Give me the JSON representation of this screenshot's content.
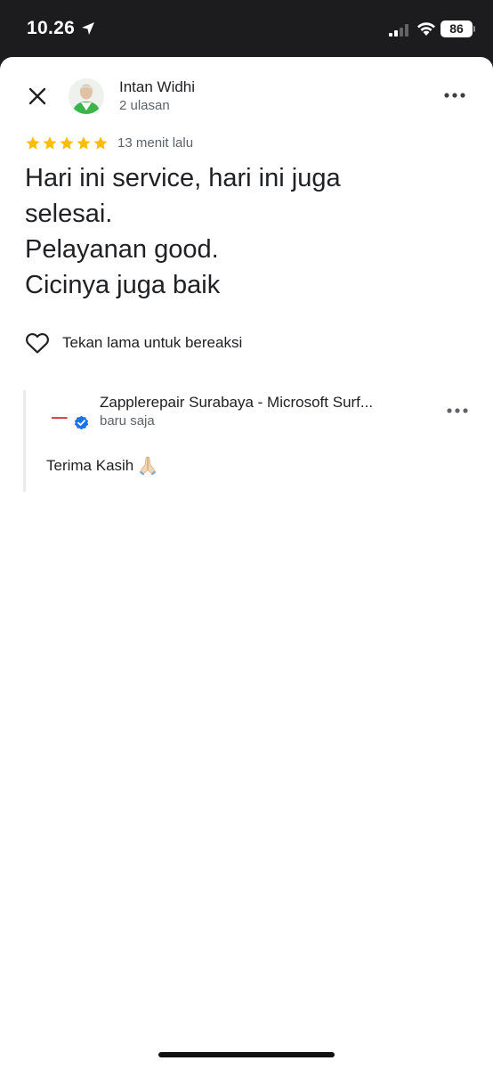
{
  "status_bar": {
    "time": "10.26",
    "battery": "86"
  },
  "review": {
    "reviewer_name": "Intan Widhi",
    "reviewer_review_count": "2 ulasan",
    "rating": 5,
    "time_ago": "13 menit lalu",
    "text": "Hari ini service, hari ini juga\nselesai.\nPelayanan good.\nCicinya juga baik",
    "react_label": "Tekan lama untuk bereaksi"
  },
  "owner_reply": {
    "owner_name": "Zapplerepair Surabaya - Microsoft Surf...",
    "time_ago": "baru saja",
    "text": "Terima Kasih"
  },
  "colors": {
    "star": "#fbbc04",
    "verified": "#1a73e8"
  },
  "icons": [
    "location-arrow-icon",
    "signal-icon",
    "wifi-icon",
    "close-icon",
    "more-icon",
    "star-icon",
    "heart-icon",
    "verified-icon",
    "pray-emoji-icon"
  ]
}
